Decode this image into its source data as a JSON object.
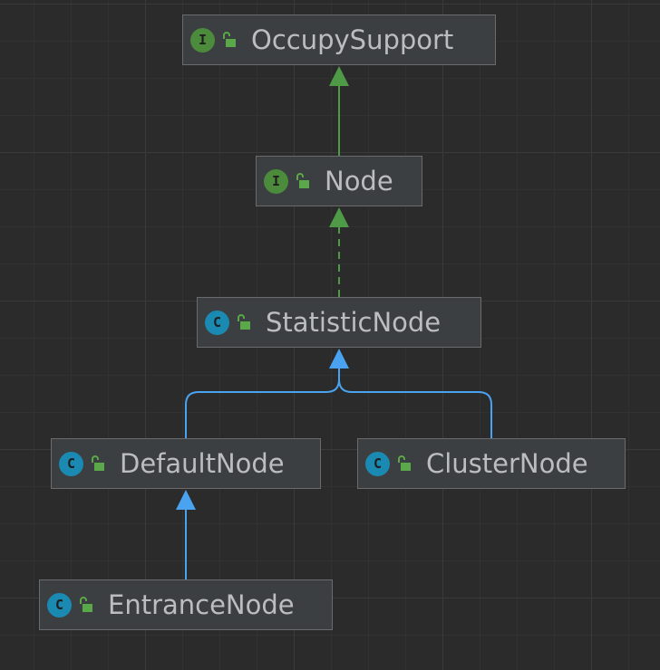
{
  "colors": {
    "background": "#2b2b2b",
    "node_fill": "#3c3f41",
    "node_border": "#6b6b6b",
    "node_text": "#bbbdbf",
    "interface_badge": "#4c8b3b",
    "class_badge": "#1b8ab2",
    "implements_edge": "#4f9a46",
    "extends_edge": "#4aa3f0"
  },
  "nodes": {
    "occupy_support": {
      "name": "OccupySupport",
      "kind_letter": "I",
      "kind": "interface",
      "visibility": "public",
      "icon": "interface-icon"
    },
    "node": {
      "name": "Node",
      "kind_letter": "I",
      "kind": "interface",
      "visibility": "public",
      "icon": "interface-icon"
    },
    "statistic_node": {
      "name": "StatisticNode",
      "kind_letter": "C",
      "kind": "class",
      "visibility": "public",
      "icon": "class-icon"
    },
    "default_node": {
      "name": "DefaultNode",
      "kind_letter": "C",
      "kind": "class",
      "visibility": "public",
      "icon": "class-icon"
    },
    "cluster_node": {
      "name": "ClusterNode",
      "kind_letter": "C",
      "kind": "class",
      "visibility": "public",
      "icon": "class-icon"
    },
    "entrance_node": {
      "name": "EntranceNode",
      "kind_letter": "C",
      "kind": "class",
      "visibility": "public",
      "icon": "class-icon"
    }
  },
  "edges": [
    {
      "from": "Node",
      "to": "OccupySupport",
      "type": "extends-interface",
      "style": "solid",
      "color": "green"
    },
    {
      "from": "StatisticNode",
      "to": "Node",
      "type": "implements",
      "style": "dashed",
      "color": "green"
    },
    {
      "from": "DefaultNode",
      "to": "StatisticNode",
      "type": "extends",
      "style": "solid",
      "color": "blue"
    },
    {
      "from": "ClusterNode",
      "to": "StatisticNode",
      "type": "extends",
      "style": "solid",
      "color": "blue"
    },
    {
      "from": "EntranceNode",
      "to": "DefaultNode",
      "type": "extends",
      "style": "solid",
      "color": "blue"
    }
  ]
}
